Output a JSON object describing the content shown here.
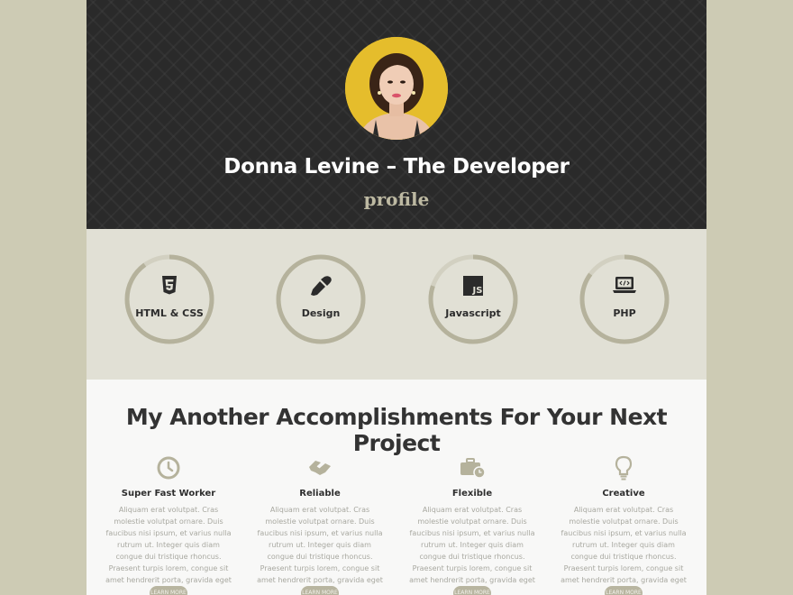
{
  "hero": {
    "title": "Donna Levine – The Developer",
    "subtitle": "profile"
  },
  "skills": [
    {
      "label": "HTML & CSS",
      "icon": "html5-icon",
      "progress": 0.9
    },
    {
      "label": "Design",
      "icon": "eyedropper-icon",
      "progress": 1.0
    },
    {
      "label": "Javascript",
      "icon": "javascript-icon",
      "progress": 0.8
    },
    {
      "label": "PHP",
      "icon": "laptop-code-icon",
      "progress": 0.85
    }
  ],
  "accomplishments": {
    "title": "My Another Accomplishments For Your Next Project",
    "items": [
      {
        "name": "Super Fast Worker",
        "icon": "clock-icon",
        "description": "Aliquam erat volutpat. Cras molestie volutpat ornare. Duis faucibus nisi ipsum, et varius nulla rutrum ut. Integer quis diam congue dui tristique rhoncus. Praesent turpis lorem, congue sit amet hendrerit porta, gravida eget tellus.",
        "button": "LEARN MORE"
      },
      {
        "name": "Reliable",
        "icon": "handshake-icon",
        "description": "Aliquam erat volutpat. Cras molestie volutpat ornare. Duis faucibus nisi ipsum, et varius nulla rutrum ut. Integer quis diam congue dui tristique rhoncus. Praesent turpis lorem, congue sit amet hendrerit porta, gravida eget tellus.",
        "button": "LEARN MORE"
      },
      {
        "name": "Flexible",
        "icon": "briefcase-clock-icon",
        "description": "Aliquam erat volutpat. Cras molestie volutpat ornare. Duis faucibus nisi ipsum, et varius nulla rutrum ut. Integer quis diam congue dui tristique rhoncus. Praesent turpis lorem, congue sit amet hendrerit porta, gravida eget tellus.",
        "button": "LEARN MORE"
      },
      {
        "name": "Creative",
        "icon": "lightbulb-icon",
        "description": "Aliquam erat volutpat. Cras molestie volutpat ornare. Duis faucibus nisi ipsum, et varius nulla rutrum ut. Integer quis diam congue dui tristique rhoncus. Praesent turpis lorem, congue sit amet hendrerit porta, gravida eget tellus.",
        "button": "LEARN MORE"
      }
    ]
  },
  "colors": {
    "page_background": "#cdcbb4",
    "hero_background": "#2a2a2a",
    "accent": "#b8b5a0",
    "skills_background": "#e1e0d5"
  }
}
